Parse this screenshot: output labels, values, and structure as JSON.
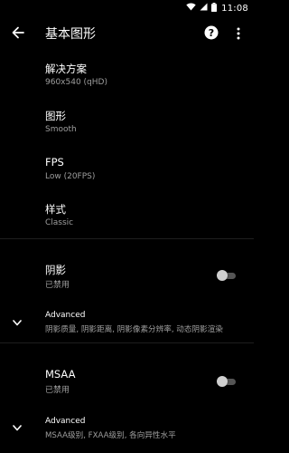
{
  "status_bar": {
    "time": "11:08",
    "icons": [
      "wifi-icon",
      "signal-icon",
      "battery-icon"
    ]
  },
  "app_bar": {
    "title": "基本图形",
    "back_icon": "arrow-left-icon",
    "help_icon": "help-circle-icon",
    "more_icon": "more-vert-icon"
  },
  "settings": {
    "resolution": {
      "title": "解决方案",
      "value": "960x540 (qHD)"
    },
    "graphics": {
      "title": "图形",
      "value": "Smooth"
    },
    "fps": {
      "title": "FPS",
      "value": "Low (20FPS)"
    },
    "style": {
      "title": "样式",
      "value": "Classic"
    },
    "shadow": {
      "title": "阴影",
      "value": "已禁用",
      "enabled": false
    },
    "shadow_advanced": {
      "title": "Advanced",
      "summary": "阴影质量, 阴影距离, 阴影像素分辨率, 动态阴影渲染"
    },
    "msaa": {
      "title": "MSAA",
      "value": "已禁用",
      "enabled": false
    },
    "msaa_advanced": {
      "title": "Advanced",
      "summary": "MSAA级别, FXAA级别, 各向异性水平"
    }
  },
  "colors": {
    "background": "#000000",
    "text_primary": "#ffffff",
    "text_secondary": "#9e9e9e",
    "divider": "#1e1e1e",
    "toggle_off_thumb": "#cfcfcf",
    "toggle_off_track": "#555555"
  }
}
